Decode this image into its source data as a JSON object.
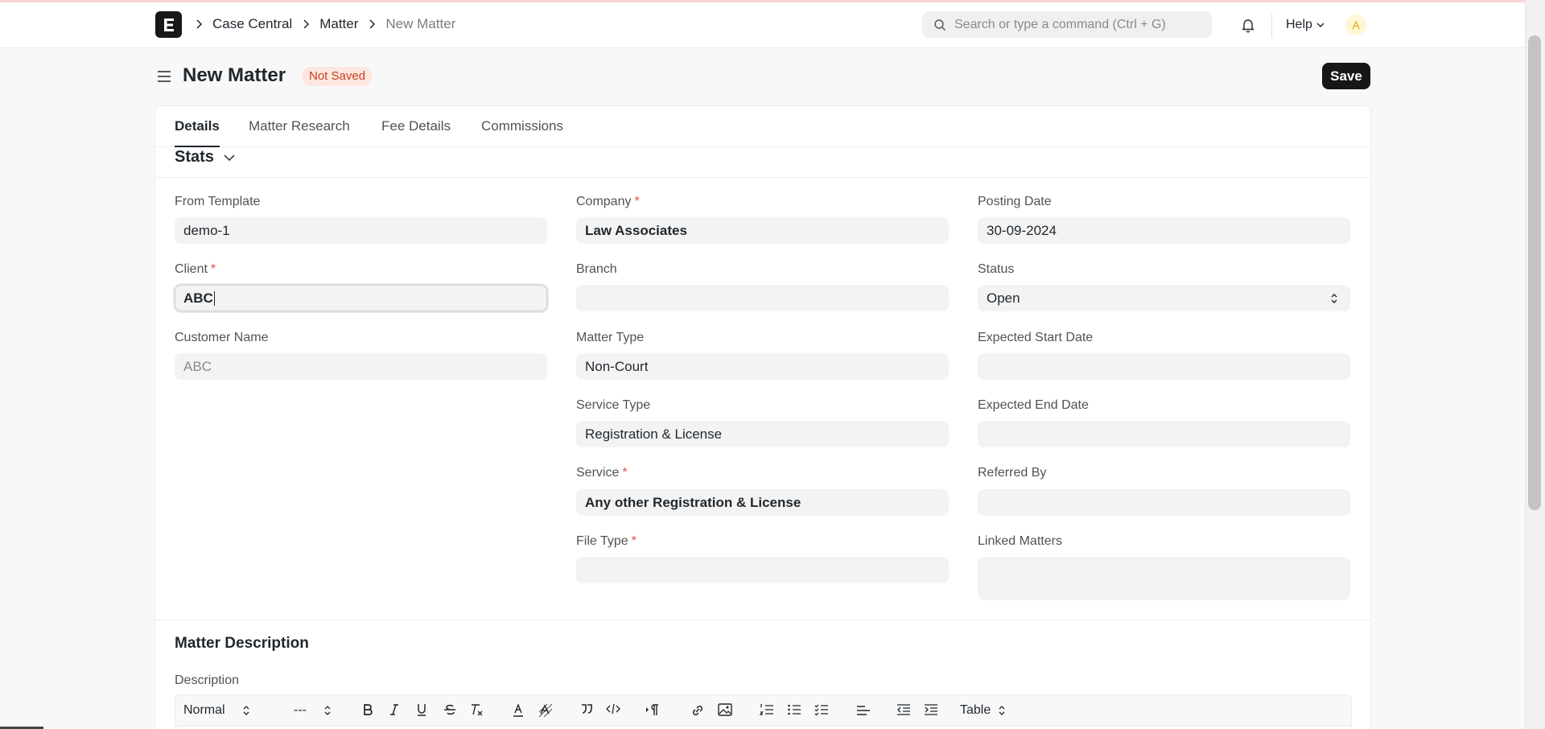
{
  "breadcrumbs": [
    "Case Central",
    "Matter",
    "New Matter"
  ],
  "search": {
    "placeholder": "Search or type a command (Ctrl + G)"
  },
  "nav": {
    "help_label": "Help",
    "avatar_letter": "A"
  },
  "page": {
    "title": "New Matter",
    "status_badge": "Not Saved",
    "save_label": "Save"
  },
  "tabs": [
    "Details",
    "Matter Research",
    "Fee Details",
    "Commissions"
  ],
  "section": {
    "title": "Stats"
  },
  "fields": {
    "from_template": {
      "label": "From Template",
      "value": "demo-1"
    },
    "client": {
      "label": "Client",
      "value": "ABC"
    },
    "customer_name": {
      "label": "Customer Name",
      "value": "ABC"
    },
    "company": {
      "label": "Company",
      "value": "Law Associates"
    },
    "branch": {
      "label": "Branch",
      "value": ""
    },
    "matter_type": {
      "label": "Matter Type",
      "value": "Non-Court"
    },
    "service_type": {
      "label": "Service Type",
      "value": "Registration & License"
    },
    "service": {
      "label": "Service",
      "value": "Any other Registration & License"
    },
    "file_type": {
      "label": "File Type",
      "value": ""
    },
    "posting_date": {
      "label": "Posting Date",
      "value": "30-09-2024"
    },
    "status": {
      "label": "Status",
      "value": "Open"
    },
    "expected_start_date": {
      "label": "Expected Start Date",
      "value": ""
    },
    "expected_end_date": {
      "label": "Expected End Date",
      "value": ""
    },
    "referred_by": {
      "label": "Referred By",
      "value": ""
    },
    "linked_matters": {
      "label": "Linked Matters",
      "value": ""
    }
  },
  "required_marker": "*",
  "description_section": {
    "title": "Matter Description",
    "field_label": "Description"
  },
  "editor_toolbar": {
    "text_style": "Normal",
    "font_size": "---",
    "table_label": "Table"
  }
}
